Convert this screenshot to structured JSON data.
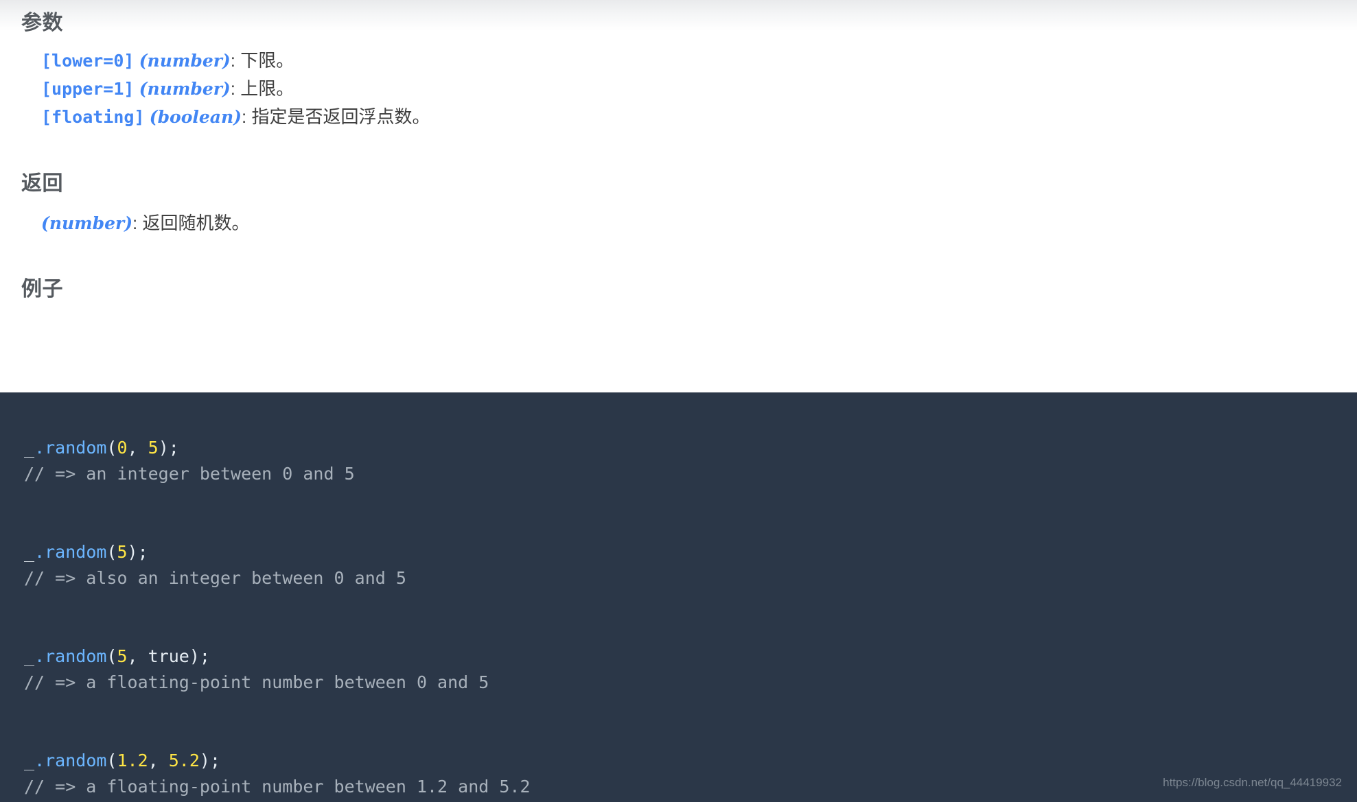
{
  "sections": {
    "params_heading": "参数",
    "returns_heading": "返回",
    "examples_heading": "例子"
  },
  "params": [
    {
      "name": "[lower=0]",
      "type": "(number)",
      "sep": ": ",
      "desc": "下限。"
    },
    {
      "name": "[upper=1]",
      "type": "(number)",
      "sep": ": ",
      "desc": "上限。"
    },
    {
      "name": "[floating]",
      "type": "(boolean)",
      "sep": ": ",
      "desc": "指定是否返回浮点数。"
    }
  ],
  "returns": [
    {
      "name": "",
      "type": "(number)",
      "sep": ": ",
      "desc": "返回随机数。"
    }
  ],
  "code": {
    "examples": [
      {
        "var": "_",
        "call": ".random",
        "open": "(",
        "args": [
          {
            "text": "0",
            "kind": "num"
          },
          {
            "text": ", ",
            "kind": "punc"
          },
          {
            "text": "5",
            "kind": "num"
          }
        ],
        "close": ");",
        "comment": "// => an integer between 0 and 5"
      },
      {
        "var": "_",
        "call": ".random",
        "open": "(",
        "args": [
          {
            "text": "5",
            "kind": "num"
          }
        ],
        "close": ");",
        "comment": "// => also an integer between 0 and 5"
      },
      {
        "var": "_",
        "call": ".random",
        "open": "(",
        "args": [
          {
            "text": "5",
            "kind": "num"
          },
          {
            "text": ", ",
            "kind": "punc"
          },
          {
            "text": "true",
            "kind": "bool"
          }
        ],
        "close": ");",
        "comment": "// => a floating-point number between 0 and 5"
      },
      {
        "var": "_",
        "call": ".random",
        "open": "(",
        "args": [
          {
            "text": "1.2",
            "kind": "num"
          },
          {
            "text": ", ",
            "kind": "punc"
          },
          {
            "text": "5.2",
            "kind": "num"
          }
        ],
        "close": ");",
        "comment": "// => a floating-point number between 1.2 and 5.2"
      }
    ]
  },
  "watermark": "https://blog.csdn.net/qq_44419932",
  "colors": {
    "code_background": "#2b3748",
    "accent_blue": "#4286f4",
    "function_blue": "#6cb6ff",
    "number_yellow": "#ffe545",
    "comment_grey": "#a8b1bb",
    "heading_grey": "#555a5f"
  }
}
